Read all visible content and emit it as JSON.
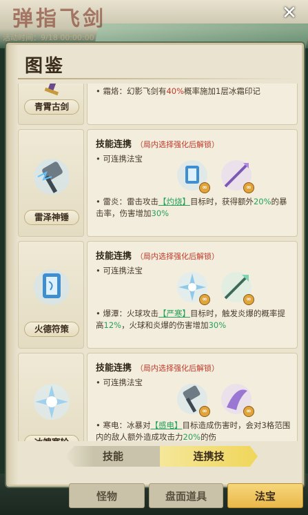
{
  "background": {
    "title": "弹指飞剑",
    "timer": "活动时间：9/18 00:00:00"
  },
  "panel": {
    "title": "图鉴"
  },
  "entries": [
    {
      "name": "青霄古剑",
      "skill_title": "",
      "lock_note": "",
      "bullets": [
        {
          "prefix": "• 霜烙：幻影飞剑有",
          "hl": "40%",
          "suffix": "概率施加1层冰霜印记"
        }
      ]
    },
    {
      "name": "雷泽神锤",
      "skill_title": "技能连携",
      "lock_note": "（局内选择强化后解锁）",
      "linkable": "• 可连携法宝",
      "effect": {
        "pre": "• 雷炎：雷击攻击",
        "kw": "【灼烧】",
        "mid": "目标时，获得额外",
        "gr1": "20%",
        "mid2": "的暴击率，伤害增加",
        "gr2": "30%"
      }
    },
    {
      "name": "火德符策",
      "skill_title": "技能连携",
      "lock_note": "（局内选择强化后解锁）",
      "linkable": "• 可连携法宝",
      "effect": {
        "pre": "• 爆潭：火球攻击",
        "kw": "【严寒】",
        "mid": "目标时，触发炎爆的概率提高",
        "gr1": "12%",
        "mid2": "，火球和炎爆的伤害增加",
        "gr2": "30%"
      }
    },
    {
      "name": "冰魄寒轮",
      "skill_title": "技能连携",
      "lock_note": "（局内选择强化后解锁）",
      "linkable": "• 可连携法宝",
      "effect": {
        "pre": "• 寒电：冰暴对",
        "kw": "【感电】",
        "mid": "目标造成伤害时，会对3格范围内的敌人额外造成攻击力",
        "gr1": "20%",
        "mid2": "的伤",
        "gr2": ""
      }
    }
  ],
  "tabs": {
    "skill": "技能",
    "combo": "连携技"
  },
  "bottom_nav": {
    "monster": "怪物",
    "board_item": "盘面道具",
    "artifact": "法宝"
  },
  "colors": {
    "accent_red": "#c0392b",
    "accent_green": "#27a05a",
    "tab_active": "#f0d65a",
    "nav_active": "#e9b84a"
  }
}
